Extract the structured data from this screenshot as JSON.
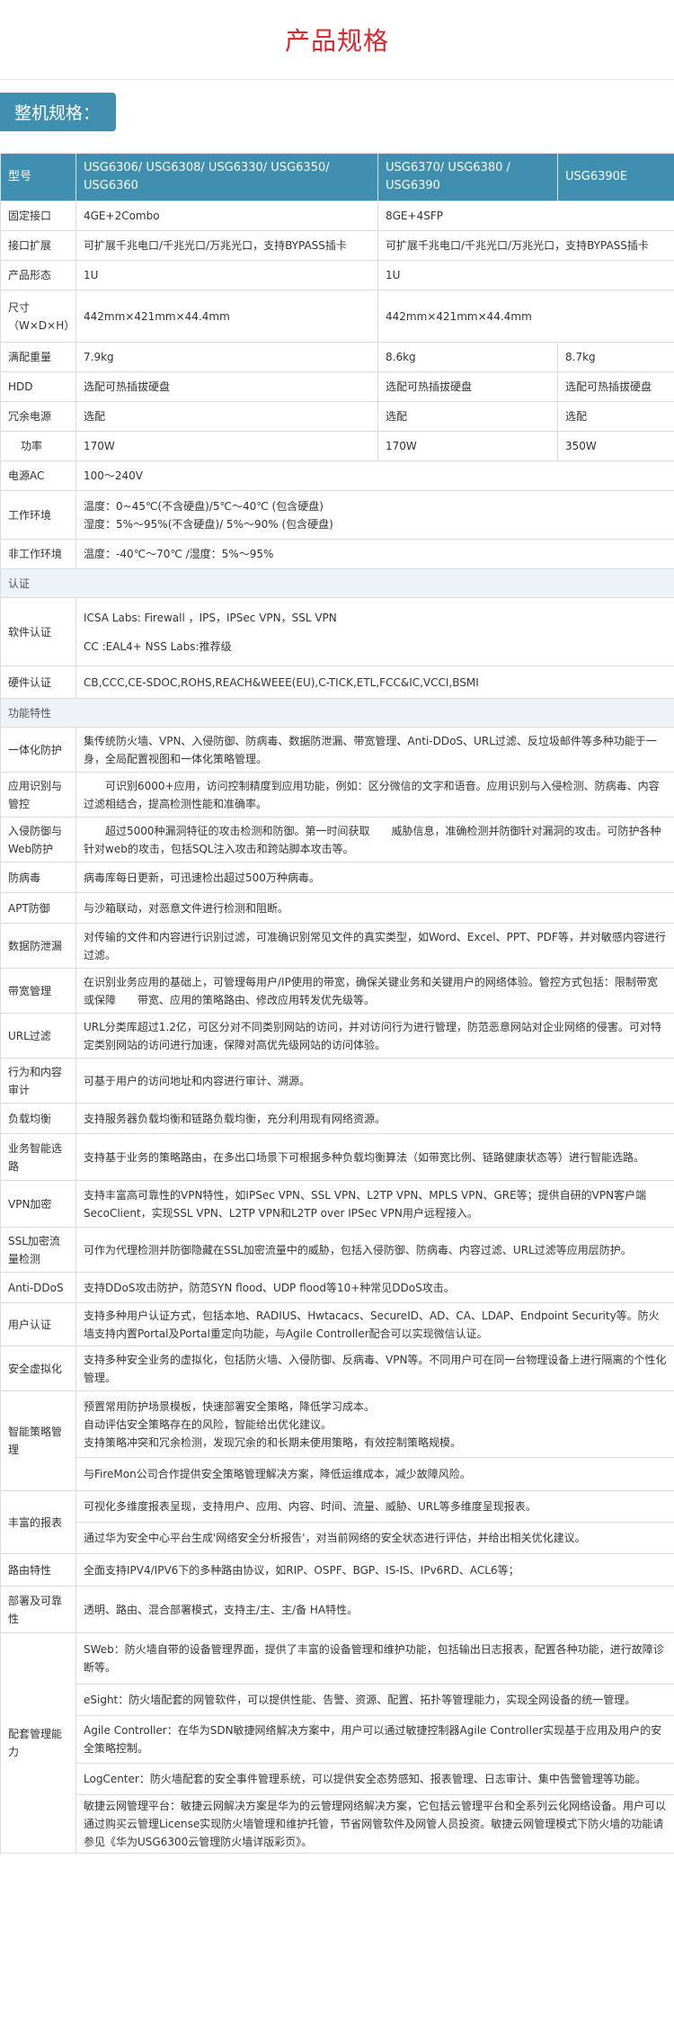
{
  "page_title": "产品规格",
  "section_tag": "整机规格：",
  "header": {
    "c0": "型号",
    "c1": "USG6306/ USG6308/ USG6330/ USG6350/ USG6360",
    "c2": "USG6370/ USG6380 / USG6390",
    "c3": "USG6390E"
  },
  "rows": {
    "fixed_ports": {
      "label": "固定接口",
      "v1": "4GE+2Combo",
      "v2": "8GE+4SFP"
    },
    "expansion": {
      "label": "接口扩展",
      "v1": "可扩展千兆电口/千兆光口/万兆光口，支持BYPASS插卡",
      "v2": "可扩展千兆电口/千兆光口/万兆光口，支持BYPASS插卡"
    },
    "form": {
      "label": "产品形态",
      "v1": "1U",
      "v2": "1U"
    },
    "size": {
      "label": "尺寸（W×D×H）",
      "v1": "442mm×421mm×44.4mm",
      "v2": "442mm×421mm×44.4mm"
    },
    "weight": {
      "label": "满配重量",
      "v1": "7.9kg",
      "v2": "8.6kg",
      "v3": "8.7kg"
    },
    "hdd": {
      "label": "HDD",
      "v1": "选配可热插拔硬盘",
      "v2": "选配可热插拔硬盘",
      "v3": "选配可热插拔硬盘"
    },
    "psu": {
      "label": "冗余电源",
      "v1": "选配",
      "v2": "选配",
      "v3": "选配"
    },
    "power": {
      "label": "功率",
      "v1": "170W",
      "v2": "170W",
      "v3": "350W"
    },
    "ac": {
      "label": "电源AC",
      "v1": "100～240V"
    },
    "env": {
      "label": "工作环境",
      "l1": "温度：0~45℃(不含硬盘)/5℃～40℃ (包含硬盘)",
      "l2": "湿度：5%～95%(不含硬盘)/ 5%～90% (包含硬盘)"
    },
    "nonenv": {
      "label": "非工作环境",
      "v1": "温度：-40℃～70℃ /湿度：5%～95%"
    }
  },
  "cert_section": "认证",
  "cert": {
    "software": {
      "label": "软件认证",
      "l1": "ICSA Labs: Firewall ，IPS，IPSec VPN，SSL VPN",
      "l2": "CC :EAL4+ NSS Labs:推荐级"
    },
    "hardware": {
      "label": "硬件认证",
      "v": "CB,CCC,CE-SDOC,ROHS,REACH&WEEE(EU),C-TICK,ETL,FCC&IC,VCCI,BSMI"
    }
  },
  "feature_section": "功能特性",
  "features": [
    {
      "label": "一体化防护",
      "text": "集传统防火墙、VPN、入侵防御、防病毒、数据防泄漏、带宽管理、Anti-DDoS、URL过滤、反垃圾邮件等多种功能于一身，全局配置视图和一体化策略管理。"
    },
    {
      "label": "应用识别与管控",
      "text": "　　可识别6000+应用，访问控制精度到应用功能，例如：区分微信的文字和语音。应用识别与入侵检测、防病毒、内容过滤相结合，提高检测性能和准确率。"
    },
    {
      "label": "入侵防御与Web防护",
      "text": "　　超过5000种漏洞特征的攻击检测和防御。第一时间获取　　威胁信息，准确检测并防御针对漏洞的攻击。可防护各种针对web的攻击，包括SQL注入攻击和跨站脚本攻击等。"
    },
    {
      "label": "防病毒",
      "text": "病毒库每日更新，可迅速检出超过500万种病毒。"
    },
    {
      "label": "APT防御",
      "text": "与沙箱联动，对恶意文件进行检测和阻断。"
    },
    {
      "label": "数据防泄漏",
      "text": "对传输的文件和内容进行识别过滤，可准确识别常见文件的真实类型，如Word、Excel、PPT、PDF等，并对敏感内容进行过滤。"
    },
    {
      "label": "带宽管理",
      "text": "在识别业务应用的基础上，可管理每用户/IP使用的带宽，确保关键业务和关键用户的网络体验。管控方式包括：限制带宽或保障　　带宽、应用的策略路由、修改应用转发优先级等。"
    },
    {
      "label": "URL过滤",
      "text": "URL分类库超过1.2亿，可区分对不同类别网站的访问，并对访问行为进行管理，防范恶意网站对企业网络的侵害。可对特定类别网站的访问进行加速，保障对高优先级网站的访问体验。"
    },
    {
      "label": "行为和内容审计",
      "text": "可基于用户的访问地址和内容进行审计、溯源。"
    },
    {
      "label": "负载均衡",
      "text": "支持服务器负载均衡和链路负载均衡，充分利用现有网络资源。"
    },
    {
      "label": "业务智能选路",
      "text": "支持基于业务的策略路由，在多出口场景下可根据多种负载均衡算法（如带宽比例、链路健康状态等）进行智能选路。"
    },
    {
      "label": "VPN加密",
      "text": "支持丰富高可靠性的VPN特性，如IPSec VPN、SSL VPN、L2TP VPN、MPLS VPN、GRE等；提供自研的VPN客户端SecoClient，实现SSL VPN、L2TP VPN和L2TP over IPSec VPN用户远程接入。"
    },
    {
      "label": "SSL加密流量检测",
      "text": "可作为代理检测并防御隐藏在SSL加密流量中的威胁，包括入侵防御、防病毒、内容过滤、URL过滤等应用层防护。"
    },
    {
      "label": "Anti-DDoS",
      "text": "支持DDoS攻击防护，防范SYN flood、UDP flood等10+种常见DDoS攻击。"
    },
    {
      "label": "用户认证",
      "text": "支持多种用户认证方式，包括本地、RADIUS、Hwtacacs、SecureID、AD、CA、LDAP、Endpoint Security等。防火墙支持内置Portal及Portal重定向功能，与Agile Controller配合可以实现微信认证。"
    },
    {
      "label": "安全虚拟化",
      "text": "支持多种安全业务的虚拟化，包括防火墙、入侵防御、反病毒、VPN等。不同用户可在同一台物理设备上进行隔离的个性化管理。"
    }
  ],
  "policy": {
    "label": "智能策略管理",
    "l1": "预置常用防护场景模板，快速部署安全策略，降低学习成本。",
    "l2": "自动评估安全策略存在的风险，智能给出优化建议。",
    "l3": "支持策略冲突和冗余检测，发现冗余的和长期未使用策略，有效控制策略规模。",
    "l4": "与FireMon公司合作提供安全策略管理解决方案，降低运维成本，减少故障风险。"
  },
  "report": {
    "label": "丰富的报表",
    "l1": "可视化多维度报表呈现，支持用户、应用、内容、时间、流量、威胁、URL等多维度呈现报表。",
    "l2": "通过华为安全中心平台生成'网络安全分析报告'，对当前网络的安全状态进行评估，并给出相关优化建议。"
  },
  "routing": {
    "label": "路由特性",
    "text": "全面支持IPV4/IPV6下的多种路由协议，如RIP、OSPF、BGP、IS-IS、IPv6RD、ACL6等；"
  },
  "deploy": {
    "label": "部署及可靠性",
    "text": "透明、路由、混合部署模式，支持主/主、主/备 HA特性。"
  },
  "mgmt": {
    "label": "配套管理能力",
    "l1": "SWeb：防火墙自带的设备管理界面，提供了丰富的设备管理和维护功能，包括输出日志报表，配置各种功能，进行故障诊断等。",
    "l2": "eSight：防火墙配套的网管软件，可以提供性能、告警、资源、配置、拓扑等管理能力，实现全网设备的统一管理。",
    "l3": "Agile Controller：在华为SDN敏捷网络解决方案中，用户可以通过敏捷控制器Agile Controller实现基于应用及用户的安全策略控制。",
    "l4": "LogCenter：防火墙配套的安全事件管理系统，可以提供安全态势感知、报表管理、日志审计、集中告警管理等功能。",
    "l5": "敏捷云网管理平台：敏捷云网解决方案是华为的云管理网络解决方案，它包括云管理平台和全系列云化网络设备。用户可以通过购买云管理License实现防火墙管理和维护托管，节省网管软件及网管人员投资。敏捷云网管理模式下防火墙的功能请参见《华为USG6300云管理防火墙详版彩页》。"
  }
}
